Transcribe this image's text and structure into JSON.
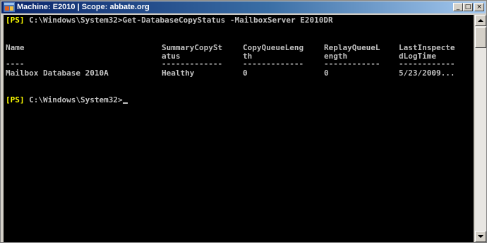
{
  "window": {
    "title": "Machine: E2010 | Scope: abbate.org",
    "minimize_glyph": "_",
    "maximize_glyph": "□",
    "close_glyph": "×"
  },
  "console": {
    "prompt_prefix": "[PS]",
    "command_line": " C:\\Windows\\System32>Get-DatabaseCopyStatus -MailboxServer E2010DR",
    "headers": [
      {
        "line1": "Name",
        "line2": ""
      },
      {
        "line1": "SummaryCopySt",
        "line2": "atus"
      },
      {
        "line1": "CopyQueueLeng",
        "line2": "th"
      },
      {
        "line1": "ReplayQueueL",
        "line2": "ength"
      },
      {
        "line1": "LastInspecte",
        "line2": "dLogTime"
      }
    ],
    "separators": [
      "----",
      "-------------",
      "-------------",
      "------------",
      "------------"
    ],
    "rows": [
      [
        "Mailbox Database 2010A",
        "Healthy",
        "0",
        "0",
        "5/23/2009..."
      ]
    ],
    "prompt_path": " C:\\Windows\\System32>"
  }
}
